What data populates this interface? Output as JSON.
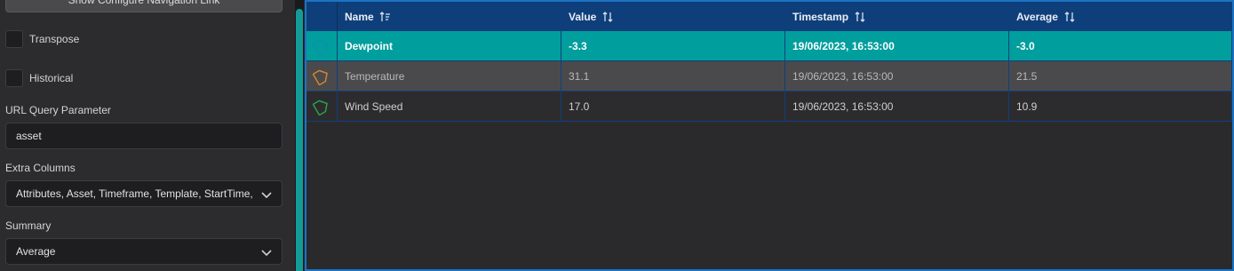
{
  "left": {
    "nav_button_label": "Show Configure Navigation Link",
    "transpose_label": "Transpose",
    "historical_label": "Historical",
    "url_query_label": "URL Query Parameter",
    "url_query_value": "asset",
    "extra_columns_label": "Extra Columns",
    "extra_columns_value": "Attributes, Asset, Timeframe, Template, StartTime, ",
    "summary_label": "Summary",
    "summary_value": "Average"
  },
  "table": {
    "columns": [
      "Name",
      "Value",
      "Timestamp",
      "Average"
    ],
    "rows": [
      {
        "name": "Dewpoint",
        "value": "-3.3",
        "timestamp": "19/06/2023, 16:53:00",
        "average": "-3.0",
        "icon": "tag-icon",
        "color": "#0f8fb0"
      },
      {
        "name": "Temperature",
        "value": "31.1",
        "timestamp": "19/06/2023, 16:53:00",
        "average": "21.5",
        "icon": "tag-icon",
        "color": "#e0862a"
      },
      {
        "name": "Wind Speed",
        "value": "17.0",
        "timestamp": "19/06/2023, 16:53:00",
        "average": "10.9",
        "icon": "tag-icon",
        "color": "#2aa84a"
      }
    ]
  },
  "colors": {
    "accent": "#009e9d",
    "header": "#0f3f7a",
    "border": "#1b73c4"
  }
}
